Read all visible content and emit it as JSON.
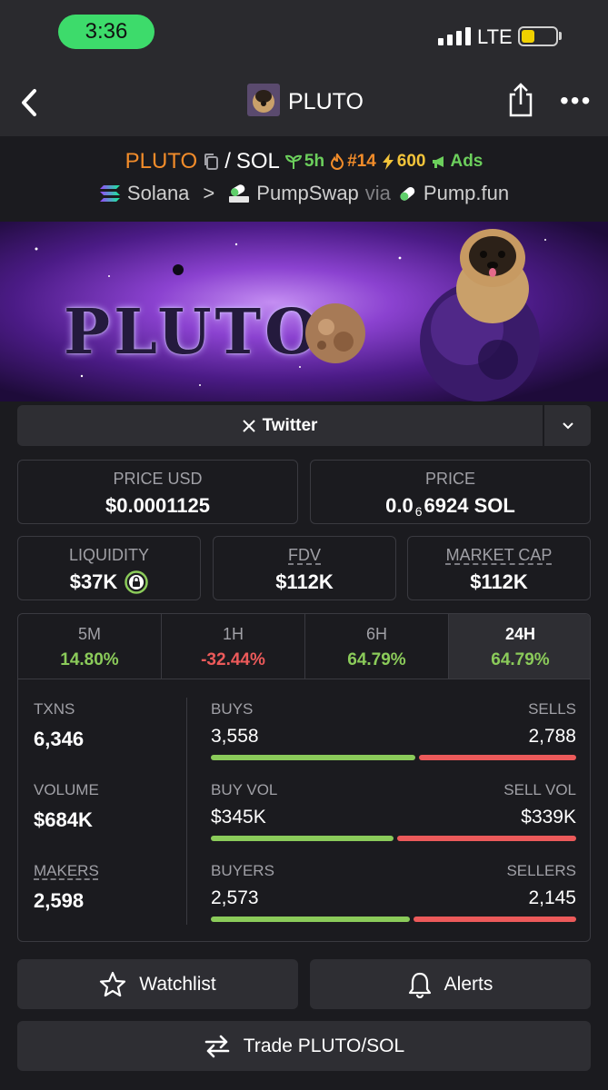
{
  "status_bar": {
    "time": "3:36",
    "network": "LTE"
  },
  "nav": {
    "title": "PLUTO"
  },
  "pair": {
    "base": "PLUTO",
    "separator": "/",
    "quote": "SOL",
    "age": "5h",
    "rank": "#14",
    "boosts": "600",
    "ads": "Ads",
    "chain": "Solana",
    "dex": "PumpSwap",
    "via": "via",
    "launchpad": "Pump.fun"
  },
  "banner": {
    "title": "PLUTO"
  },
  "socials": {
    "twitter_label": "Twitter"
  },
  "price": {
    "usd_label": "PRICE USD",
    "usd_value": "$0.0001125",
    "native_label": "PRICE",
    "native_prefix": "0.0",
    "native_zeros": "6",
    "native_digits": "6924 SOL"
  },
  "metrics": {
    "liquidity_label": "LIQUIDITY",
    "liquidity_value": "$37K",
    "fdv_label": "FDV",
    "fdv_value": "$112K",
    "mcap_label": "MARKET CAP",
    "mcap_value": "$112K"
  },
  "timeframes": [
    {
      "label": "5M",
      "value": "14.80%"
    },
    {
      "label": "1H",
      "value": "-32.44%"
    },
    {
      "label": "6H",
      "value": "64.79%"
    },
    {
      "label": "24H",
      "value": "64.79%"
    }
  ],
  "stats": {
    "txns_label": "TXNS",
    "txns_value": "6,346",
    "volume_label": "VOLUME",
    "volume_value": "$684K",
    "makers_label": "MAKERS",
    "makers_value": "2,598",
    "buys_label": "BUYS",
    "buys_value": "3,558",
    "sells_label": "SELLS",
    "sells_value": "2,788",
    "buy_ratio": 0.56,
    "buyvol_label": "BUY VOL",
    "buyvol_value": "$345K",
    "sellvol_label": "SELL VOL",
    "sellvol_value": "$339K",
    "buyvol_ratio": 0.5,
    "buyers_label": "BUYERS",
    "buyers_value": "2,573",
    "sellers_label": "SELLERS",
    "sellers_value": "2,145",
    "buyers_ratio": 0.545
  },
  "actions": {
    "watchlist": "Watchlist",
    "alerts": "Alerts",
    "trade": "Trade PLUTO/SOL"
  },
  "colors": {
    "positive": "#8bcb5a",
    "negative": "#ec5a5a",
    "accent_orange": "#f28c2a",
    "status_green": "#3ddb6b"
  }
}
